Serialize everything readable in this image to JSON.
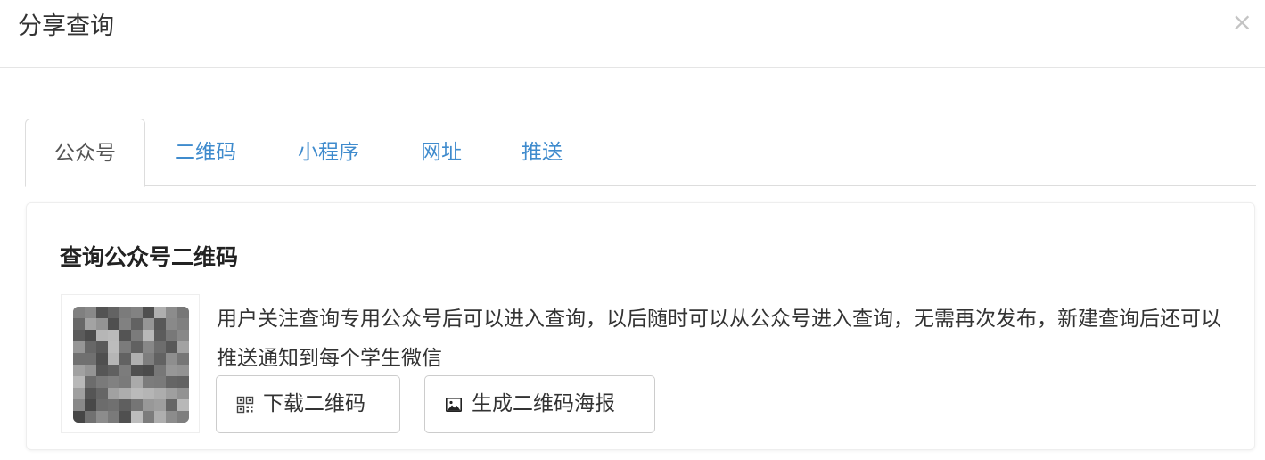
{
  "modal": {
    "title": "分享查询",
    "close_label": "×"
  },
  "tabs": [
    {
      "label": "公众号",
      "active": true
    },
    {
      "label": "二维码",
      "active": false
    },
    {
      "label": "小程序",
      "active": false
    },
    {
      "label": "网址",
      "active": false
    },
    {
      "label": "推送",
      "active": false
    }
  ],
  "panel": {
    "title": "查询公众号二维码",
    "qr_image_icon": "qr-code-image",
    "description": "用户关注查询专用公众号后可以进入查询，以后随时可以从公众号进入查询，无需再次发布，新建查询后还可以推送通知到每个学生微信",
    "buttons": {
      "download_label": "下载二维码",
      "download_icon": "qrcode-icon",
      "poster_label": "生成二维码海报",
      "poster_icon": "image-icon"
    }
  },
  "colors": {
    "link": "#3f8bcd",
    "active_tab_text": "#555555",
    "border": "#dddddd",
    "close": "#c4c4c4"
  }
}
